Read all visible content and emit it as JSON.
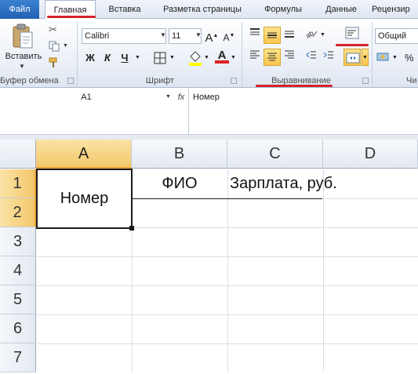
{
  "ribbon_tabs": {
    "file": "Файл",
    "home": "Главная",
    "insert": "Вставка",
    "page_layout": "Разметка страницы",
    "formulas": "Формулы",
    "data": "Данные",
    "review": "Рецензир"
  },
  "clipboard": {
    "paste_label": "Вставить",
    "group_label": "Буфер обмена"
  },
  "font": {
    "name": "Calibri",
    "size": "11",
    "bold": "Ж",
    "italic": "К",
    "underline": "Ч",
    "group_label": "Шрифт",
    "grow": "A",
    "shrink": "A",
    "color_letter": "A"
  },
  "alignment": {
    "group_label": "Выравнивание"
  },
  "number": {
    "format": "Общий",
    "percent": "%",
    "group_label": "Чи"
  },
  "formula_bar": {
    "name_box": "A1",
    "fx": "fx",
    "content": "Номер"
  },
  "sheet": {
    "columns": [
      "A",
      "B",
      "C",
      "D"
    ],
    "rows": [
      "1",
      "2",
      "3",
      "4",
      "5",
      "6",
      "7"
    ],
    "cells": {
      "a1_merged": "Номер",
      "b1": "ФИО",
      "c1": "Зарплата, руб."
    }
  },
  "colors": {
    "file_tab": "#2a6cc0",
    "annotation_red": "#d4232b",
    "selection_header": "#f3c76a",
    "highlight_button": "#f9c74f"
  }
}
